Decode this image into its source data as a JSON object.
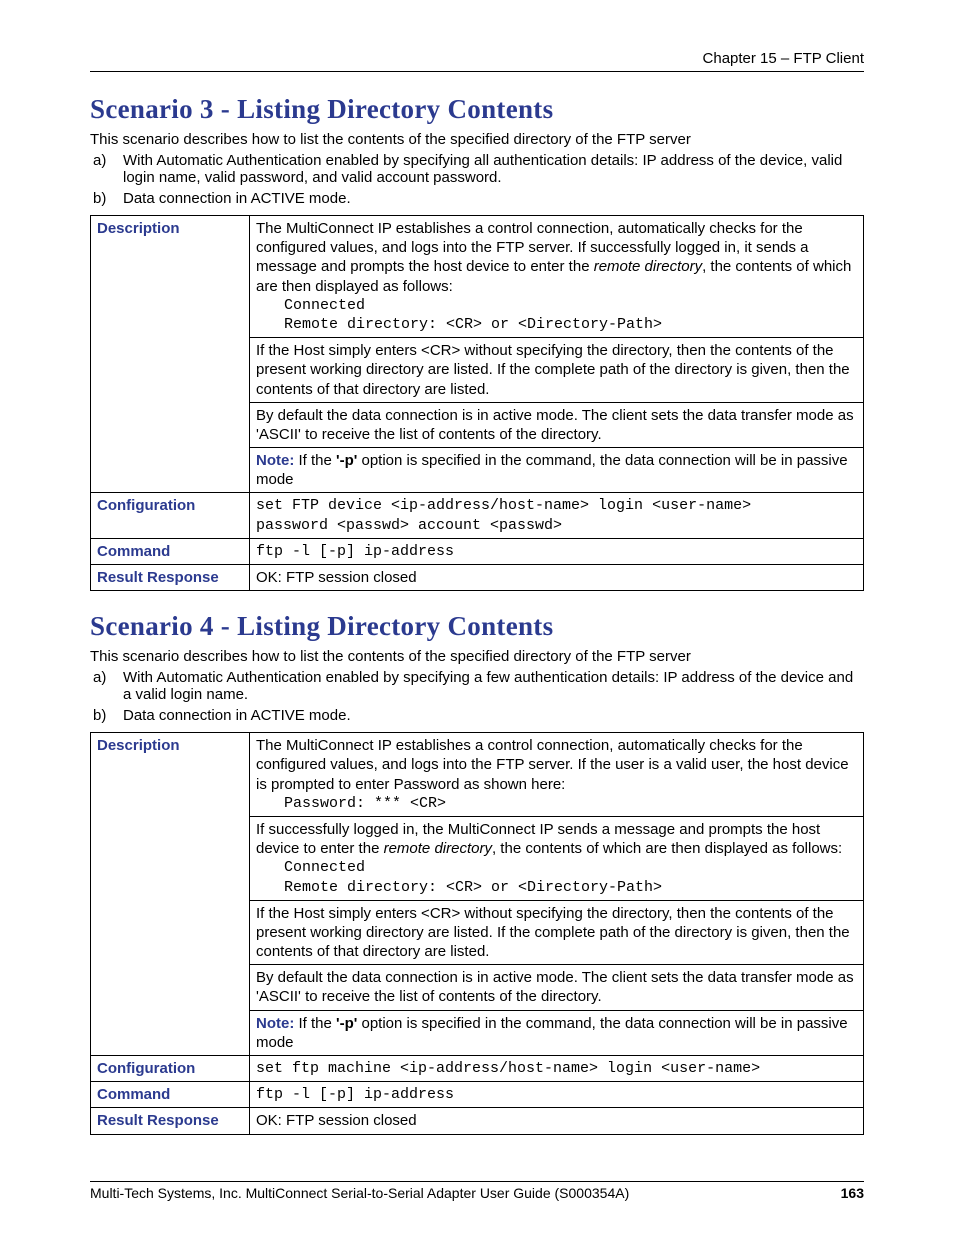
{
  "header": {
    "chapter": "Chapter 15 – FTP Client"
  },
  "s3": {
    "title": "Scenario 3 - Listing Directory Contents",
    "intro": "This scenario describes how to list the contents of the specified directory of the FTP server",
    "a_m": "a)",
    "a": "With Automatic Authentication enabled by specifying all authentication details: IP address of the device, valid login name, valid password, and valid account password.",
    "b_m": "b)",
    "b": "Data connection in ACTIVE mode.",
    "lab_desc": "Description",
    "d1a": "The MultiConnect IP establishes a control connection, automatically checks for the configured values, and logs into the FTP server. If successfully logged in, it sends a message and prompts the host device to enter the ",
    "d1b": "remote directory",
    "d1c": ", the contents of which are then displayed as follows:",
    "d1mono1": "Connected",
    "d1mono2": "Remote directory: <CR> or <Directory-Path>",
    "d2": "If the Host simply enters <CR> without specifying the directory, then the contents of the present working directory are listed. If the complete path of the directory is given, then the contents of that directory are listed.",
    "d3": "By default the data connection is in active mode. The client sets the data transfer mode as 'ASCII' to receive the list of contents of the directory.",
    "d4n": "Note:",
    "d4a": " If the ",
    "d4b": "'-p'",
    "d4c": " option is specified in the command, the data connection will be in passive mode",
    "lab_conf": "Configuration",
    "conf1": "set FTP device <ip-address/host-name> login <user-name>",
    "conf2": "password <passwd> account <passwd>",
    "lab_cmd": "Command",
    "cmd": "ftp -l [-p] ip-address",
    "lab_res": "Result Response",
    "res": "OK: FTP session closed"
  },
  "s4": {
    "title": "Scenario 4 - Listing Directory Contents",
    "intro": "This scenario describes how to list the contents of the specified directory of the FTP server",
    "a_m": "a)",
    "a": "With Automatic Authentication enabled by specifying a few authentication details: IP address of the device and a valid login name.",
    "b_m": "b)",
    "b": "Data connection in ACTIVE mode.",
    "lab_desc": "Description",
    "d1": "The MultiConnect IP establishes a control connection, automatically checks for the configured values, and logs into the FTP server. If the user is a valid user, the host device is prompted to enter Password as shown here:",
    "d1mono": "Password: *** <CR>",
    "d2a": "If successfully logged in, the MultiConnect IP sends a message and prompts the host device to enter the ",
    "d2b": "remote directory",
    "d2c": ", the contents of which are then displayed as follows:",
    "d2mono1": "Connected",
    "d2mono2": "Remote directory: <CR> or <Directory-Path>",
    "d3": "If the Host simply enters <CR> without specifying the directory, then the contents of the present working directory are listed. If the complete path of the directory is given, then the contents of that directory are listed.",
    "d4": "By default the data connection is in active mode. The client sets the data transfer mode as 'ASCII' to receive the list of contents of the directory.",
    "d5n": "Note:",
    "d5a": " If the ",
    "d5b": "'-p'",
    "d5c": " option is specified in the command, the data connection will be in passive mode",
    "lab_conf": "Configuration",
    "conf": "set ftp machine <ip-address/host-name> login <user-name>",
    "lab_cmd": "Command",
    "cmd": "ftp -l [-p] ip-address",
    "lab_res": "Result Response",
    "res": "OK: FTP session closed"
  },
  "footer": {
    "left": "Multi-Tech Systems, Inc. MultiConnect Serial-to-Serial Adapter User Guide (S000354A)",
    "page": "163"
  }
}
